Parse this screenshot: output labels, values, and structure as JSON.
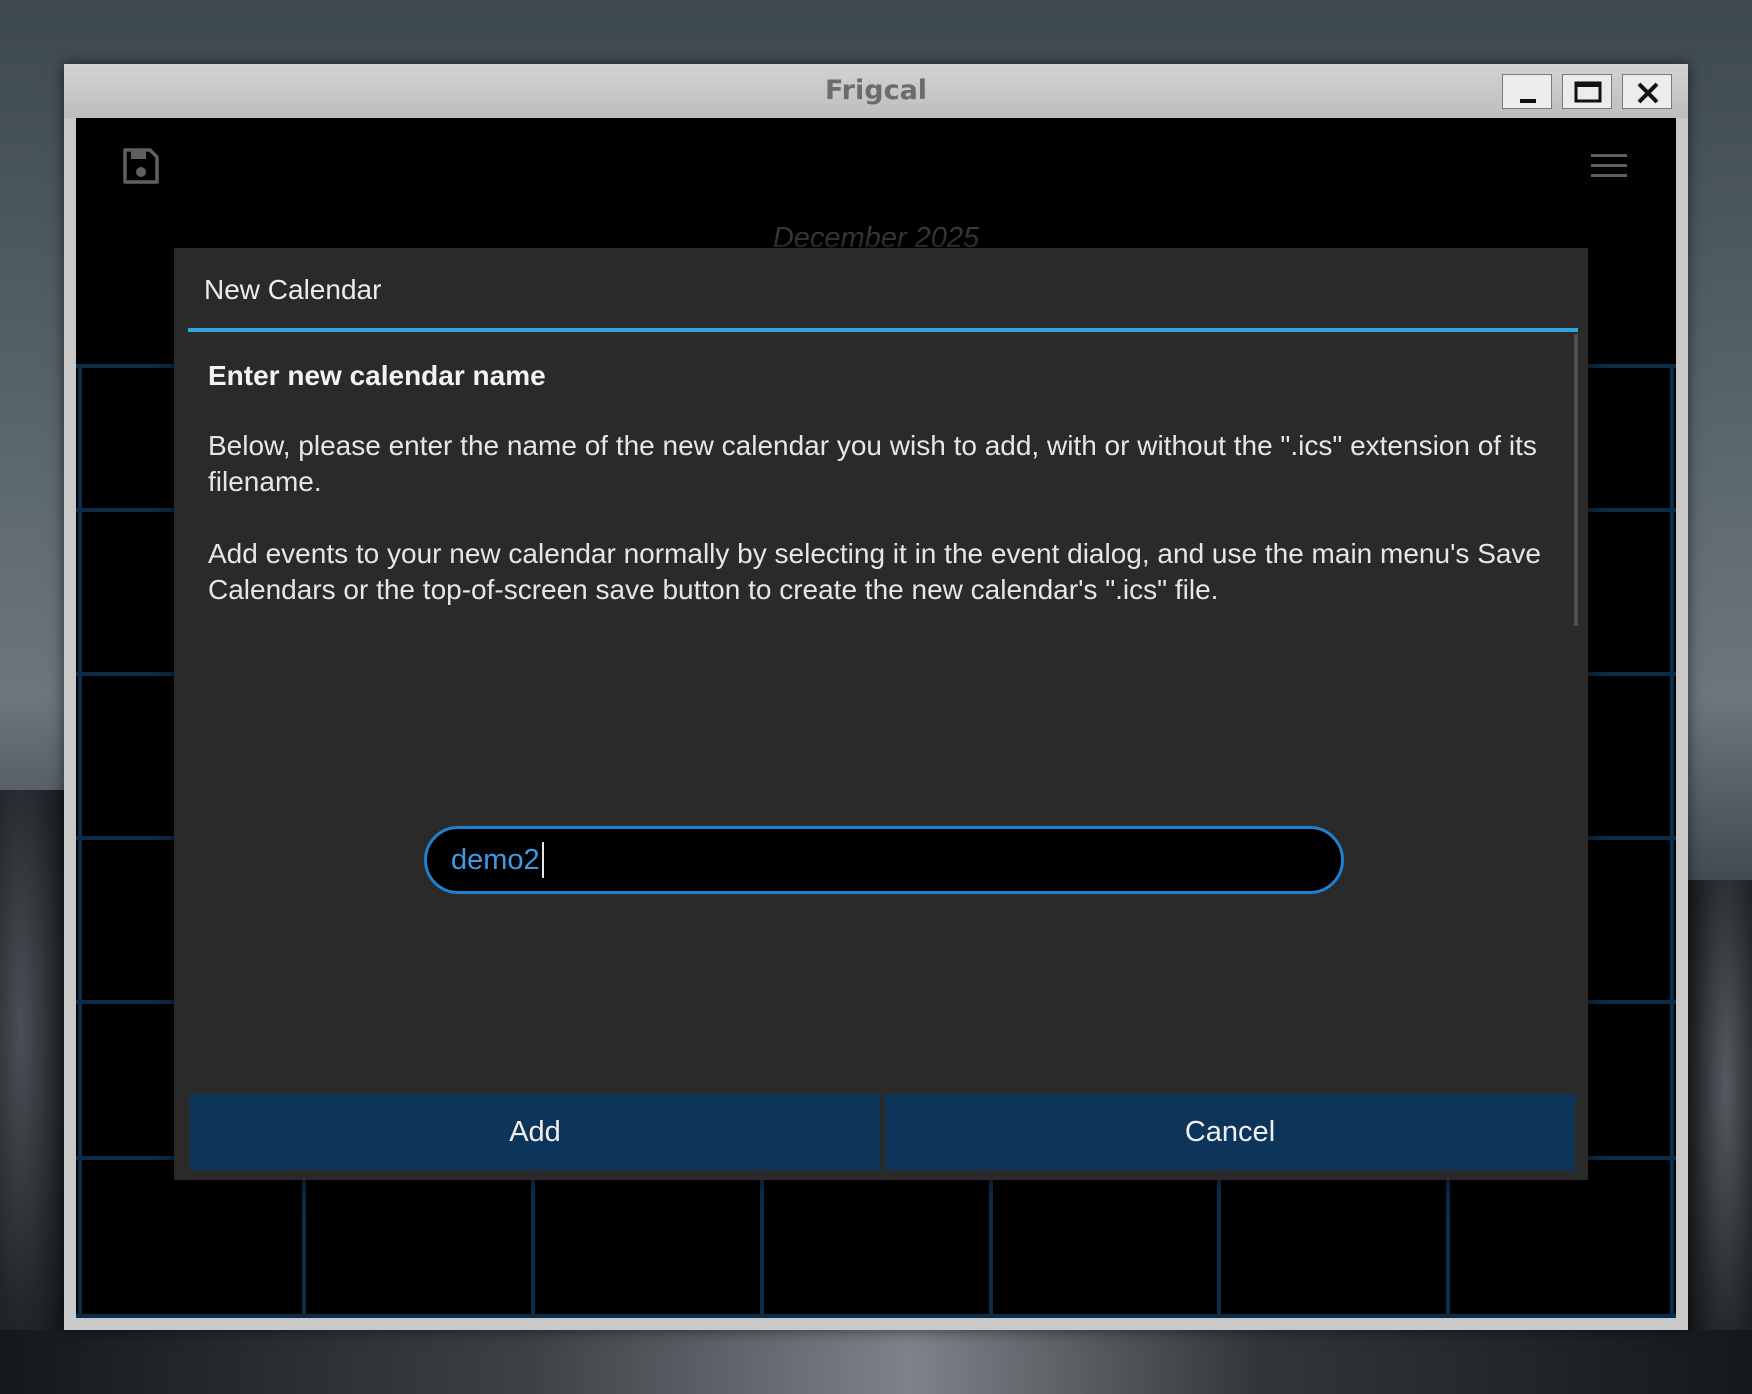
{
  "window": {
    "title": "Frigcal"
  },
  "calendar": {
    "month_title": "December 2025"
  },
  "dialog": {
    "title": "New Calendar",
    "heading": "Enter new calendar name",
    "paragraph1": "Below, please enter the name of the new calendar you wish to add, with or without the \".ics\" extension of its filename.",
    "paragraph2": "Add events to your new calendar normally by selecting it in the event dialog, and use the main menu's Save Calendars or the top-of-screen save button to create the new calendar's \".ics\" file.",
    "input_value": "demo2",
    "add_label": "Add",
    "cancel_label": "Cancel"
  },
  "colors": {
    "accent": "#32a4dc",
    "button_bg": "#0c3559",
    "grid_line": "#0d2c47",
    "input_text": "#3d9ae6"
  },
  "icons": {
    "save": "floppy-disk-icon",
    "menu": "hamburger-menu-icon",
    "minimize": "minimize-icon",
    "maximize": "maximize-icon",
    "close": "close-icon"
  }
}
